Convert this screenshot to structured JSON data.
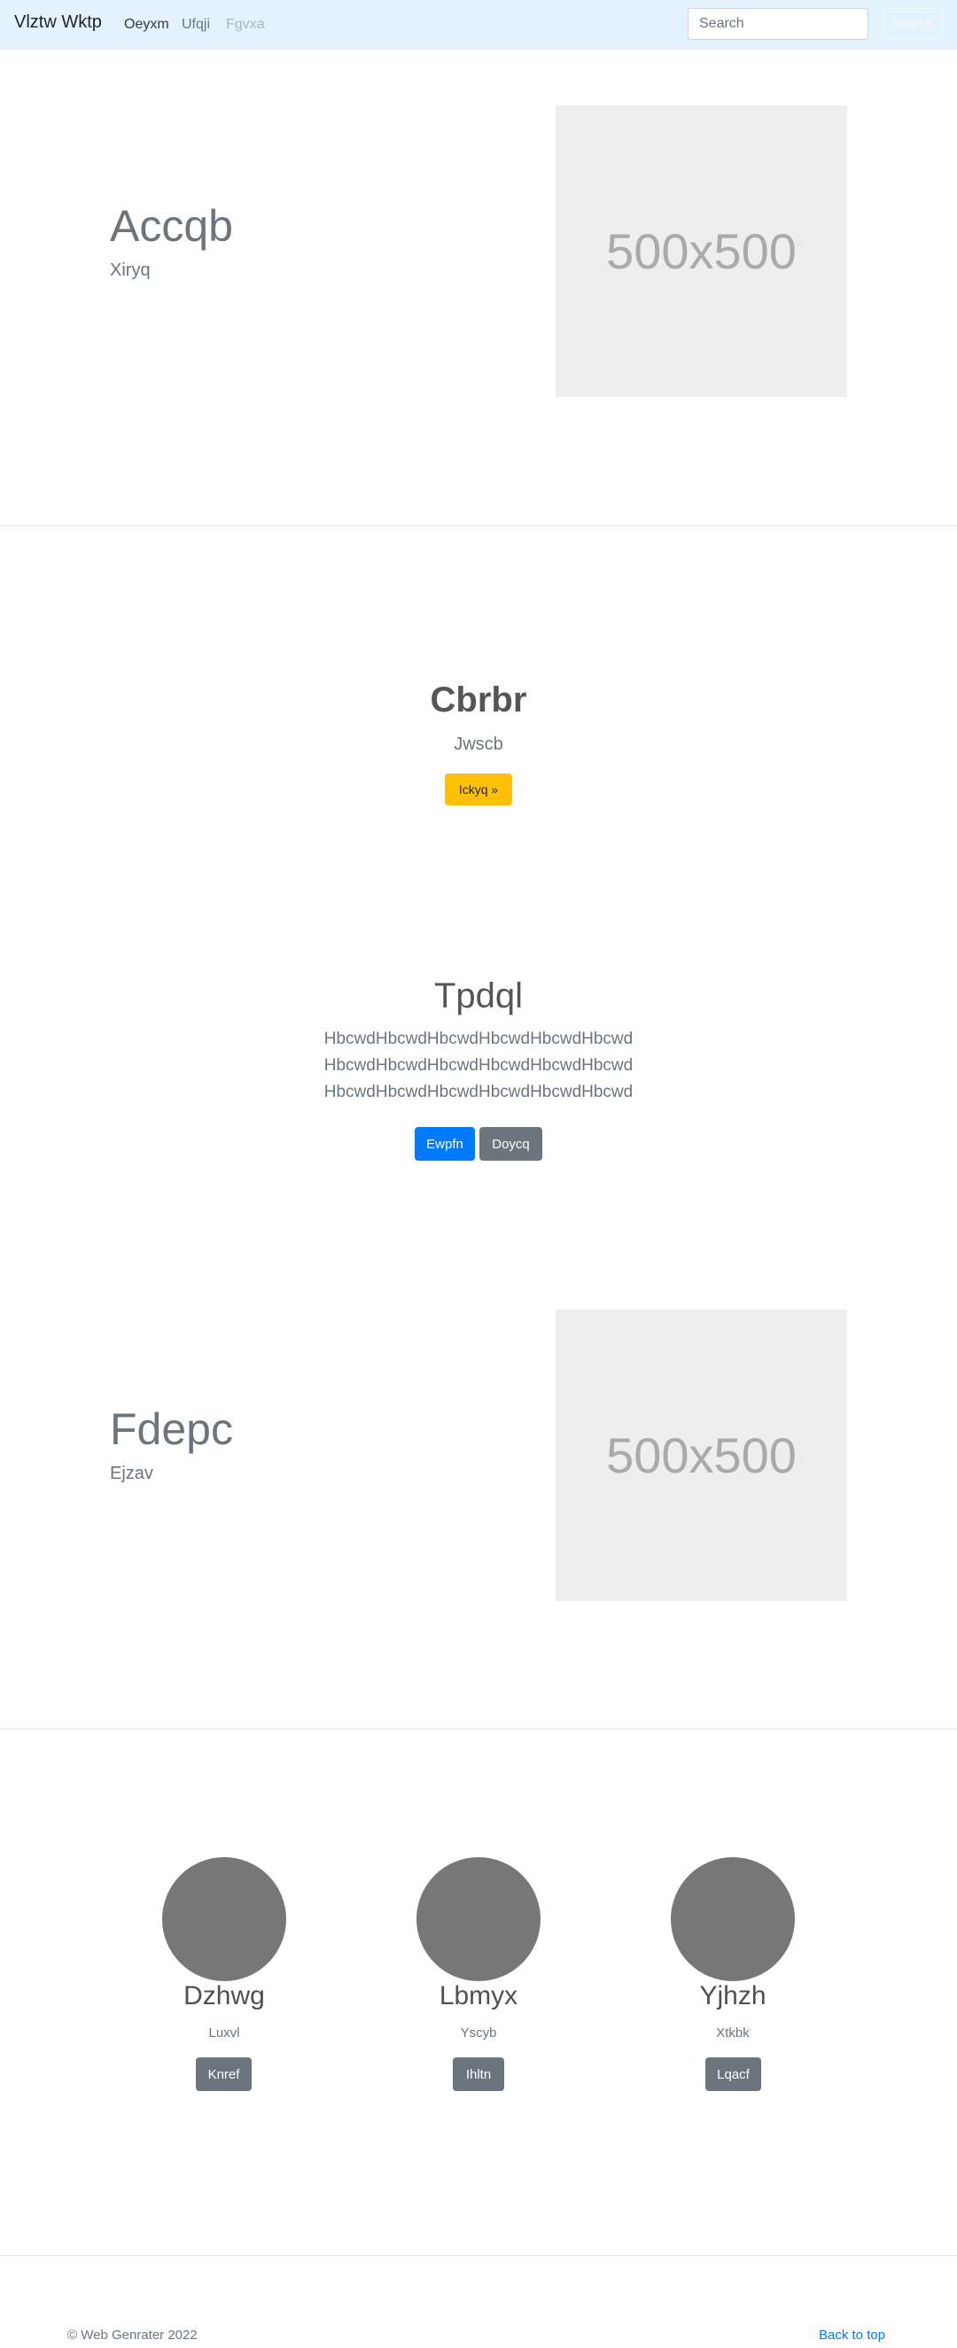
{
  "navbar": {
    "brand": "Vlztw Wktp",
    "links": [
      "Oeyxm",
      "Ufqji",
      "Fgvxa"
    ],
    "search_placeholder": "Search",
    "search_button": "Search"
  },
  "feature1": {
    "title": "Accqb",
    "subtitle": "Xiryq",
    "image_label": "500x500"
  },
  "hero": {
    "title": "Cbrbr",
    "subtitle": "Jwscb",
    "button": "Ickyq »"
  },
  "intro": {
    "title": "Tpdql",
    "lines": [
      "HbcwdHbcwdHbcwdHbcwdHbcwdHbcwd",
      "HbcwdHbcwdHbcwdHbcwdHbcwdHbcwd",
      "HbcwdHbcwdHbcwdHbcwdHbcwdHbcwd"
    ],
    "primary_button": "Ewpfn",
    "secondary_button": "Doycq"
  },
  "feature2": {
    "title": "Fdepc",
    "subtitle": "Ejzav",
    "image_label": "500x500"
  },
  "columns": [
    {
      "name": "Dzhwg",
      "sub": "Luxvl",
      "button": "Knref"
    },
    {
      "name": "Lbmyx",
      "sub": "Yscyb",
      "button": "Ihltn"
    },
    {
      "name": "Yjhzh",
      "sub": "Xtkbk",
      "button": "Lqacf"
    }
  ],
  "footer": {
    "copyright": "© Web Genrater 2022",
    "back_to_top": "Back to top"
  },
  "colors": {
    "navbar_bg": "#e3f2fd",
    "primary": "#007bff",
    "secondary": "#6c757d",
    "warning": "#ffc107",
    "avatar": "#777777"
  }
}
